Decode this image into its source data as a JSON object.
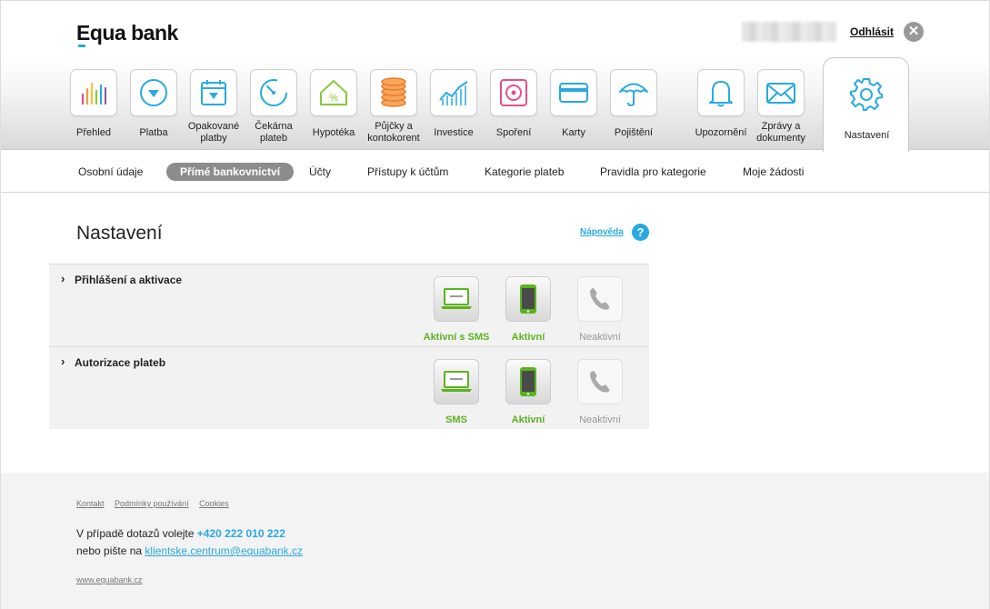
{
  "header": {
    "logo_prefix": "E",
    "logo_rest": "qua bank",
    "logout_label": "Odhlásit",
    "logout_x": "✕"
  },
  "nav": {
    "items": [
      {
        "label": "Přehled"
      },
      {
        "label": "Platba"
      },
      {
        "label": "Opakované platby"
      },
      {
        "label": "Čekárna plateb"
      },
      {
        "label": "Hypotéka"
      },
      {
        "label": "Půjčky a kontokorent"
      },
      {
        "label": "Investice"
      },
      {
        "label": "Spoření"
      },
      {
        "label": "Karty"
      },
      {
        "label": "Pojištění"
      },
      {
        "label": "Upozornění"
      },
      {
        "label": "Zprávy a dokumenty"
      }
    ],
    "settings_label": "Nastavení"
  },
  "subnav": {
    "items": [
      {
        "label": "Osobní údaje"
      },
      {
        "label": "Přímé bankovnictví"
      },
      {
        "label": "Účty"
      },
      {
        "label": "Přístupy k účtům"
      },
      {
        "label": "Kategorie plateb"
      },
      {
        "label": "Pravidla pro kategorie"
      },
      {
        "label": "Moje žádosti"
      }
    ],
    "active": "Přímé bankovnictví"
  },
  "main": {
    "title": "Nastavení",
    "help_label": "Nápověda",
    "help_icon": "?",
    "sections": [
      {
        "title": "Přihlášení a aktivace",
        "chevron": "›",
        "statuses": [
          {
            "label": "Aktivní s SMS",
            "active": true
          },
          {
            "label": "Aktivní",
            "active": true
          },
          {
            "label": "Neaktivní",
            "active": false
          }
        ]
      },
      {
        "title": "Autorizace plateb",
        "chevron": "›",
        "statuses": [
          {
            "label": "SMS",
            "active": true
          },
          {
            "label": "Aktivní",
            "active": true
          },
          {
            "label": "Neaktivní",
            "active": false
          }
        ]
      }
    ]
  },
  "footer": {
    "links": [
      "Kontakt",
      "Podmínky používání",
      "Cookies"
    ],
    "line1_prefix": "V případě dotazů volejte ",
    "phone": "+420 222 010 222",
    "line2_prefix": "nebo pište na ",
    "email": "klientske.centrum@equabank.cz",
    "web": "www.equabank.cz"
  },
  "colors": {
    "accent": "#29a9e1",
    "active_green": "#5bb31e",
    "inactive_gray": "#999999"
  }
}
